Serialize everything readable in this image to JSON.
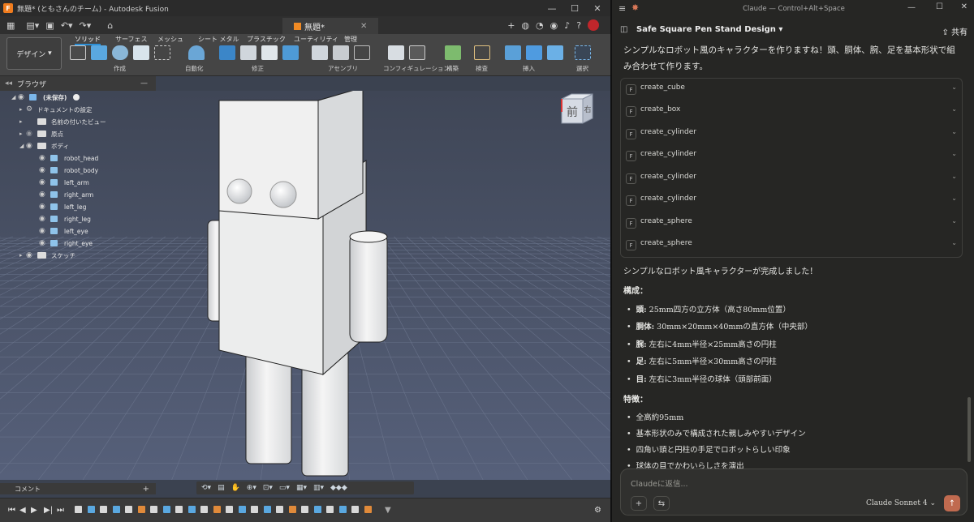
{
  "fusion": {
    "window_title": "無題* (ともさんのチーム) - Autodesk Fusion",
    "doc_tab": "無題*",
    "workspace": "デザイン",
    "ribbon_tabs": [
      "ソリッド",
      "サーフェス",
      "メッシュ",
      "シート メタル",
      "プラスチック",
      "ユーティリティ",
      "管理"
    ],
    "ribbon_groups": [
      "作成",
      "自動化",
      "修正",
      "アセンブリ",
      "コンフィギュレーション",
      "構築",
      "検査",
      "挿入",
      "選択"
    ],
    "browser_label": "ブラウザ",
    "tree": {
      "root": "(未保存)",
      "doc_settings": "ドキュメントの設定",
      "named_views": "名前の付いたビュー",
      "origin": "原点",
      "bodies": "ボディ",
      "body_items": [
        "robot_head",
        "robot_body",
        "left_arm",
        "right_arm",
        "left_leg",
        "right_leg",
        "left_eye",
        "right_eye"
      ],
      "sketches": "スケッチ"
    },
    "viewcube_face": "前",
    "viewcube_side": "右",
    "comment_label": "コメント"
  },
  "claude": {
    "title": "Claude — Control+Alt+Space",
    "project": "Safe Square Pen Stand Design",
    "share": "共有",
    "intro": "シンプルなロボット風のキャラクターを作りますね！頭、胴体、腕、足を基本形状で組み合わせて作ります。",
    "tool_badge": "F",
    "tools": [
      "create_cube",
      "create_box",
      "create_cylinder",
      "create_cylinder",
      "create_cylinder",
      "create_cylinder",
      "create_sphere",
      "create_sphere"
    ],
    "done": "シンプルなロボット風キャラクターが完成しました！",
    "composition_heading": "構成：",
    "composition": [
      {
        "k": "頭:",
        "v": " 25mm四方の立方体（高さ80mm位置）"
      },
      {
        "k": "胴体:",
        "v": " 30mm×20mm×40mmの直方体（中央部）"
      },
      {
        "k": "腕:",
        "v": " 左右に4mm半径×25mm高さの円柱"
      },
      {
        "k": "足:",
        "v": " 左右に5mm半径×30mm高さの円柱"
      },
      {
        "k": "目:",
        "v": " 左右に3mm半径の球体（頭部前面）"
      }
    ],
    "features_heading": "特徴：",
    "features": [
      "全高約95mm",
      "基本形状のみで構成された親しみやすいデザイン",
      "四角い頭と円柱の手足でロボットらしい印象",
      "球体の目でかわいらしさを演出"
    ],
    "input_placeholder": "Claudeに返信...",
    "model": "Claude Sonnet 4"
  }
}
